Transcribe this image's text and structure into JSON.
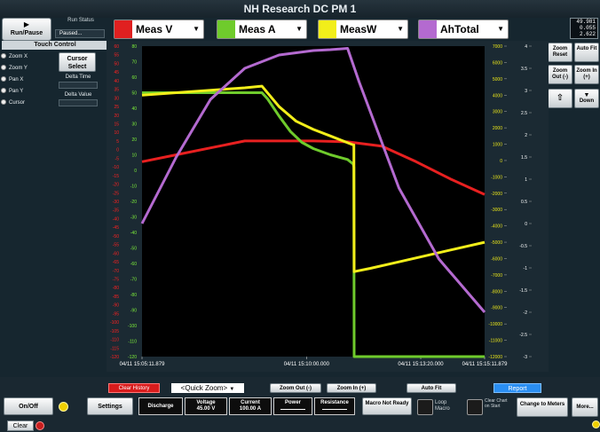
{
  "app": {
    "title": "NH Research DC PM 1"
  },
  "run": {
    "button_label": "Run/Pause",
    "status_label": "Run Status",
    "status_value": "Paused..."
  },
  "touch_control": {
    "header": "Touch Control",
    "options": [
      "Zoom X",
      "Zoom Y",
      "Pan X",
      "Pan Y",
      "Cursor"
    ],
    "cursor_select": "Cursor Select",
    "delta_time_label": "Delta Time",
    "delta_value_label": "Delta Value"
  },
  "channels": [
    {
      "name": "Meas V",
      "color": "#e02020"
    },
    {
      "name": "Meas A",
      "color": "#6fcb2c"
    },
    {
      "name": "MeasW",
      "color": "#f2ee1a"
    },
    {
      "name": "AhTotal",
      "color": "#b46ad0"
    }
  ],
  "readout": [
    "49.981",
    "0.055",
    "2.622"
  ],
  "right_buttons": {
    "zoom_reset": "Zoom Reset",
    "auto_fit": "Auto Fit",
    "zoom_out": "Zoom Out (-)",
    "zoom_in": "Zoom In (+)",
    "up": "Up",
    "down": "Down"
  },
  "chart_data": {
    "type": "line",
    "x_tick_labels": [
      "04/11 15:05:11.879",
      "04/11 15:10:00.000",
      "04/11 15:13:20.000",
      "04/11 15:15:11.879"
    ],
    "x_range_seconds": [
      0,
      600
    ],
    "x_tick_seconds": [
      0,
      288.121,
      488.121,
      600
    ],
    "axes": {
      "volts": {
        "ticks": [
          60,
          55,
          50,
          45,
          40,
          35,
          30,
          25,
          20,
          15,
          10,
          5,
          0,
          -5,
          -10,
          -15,
          -20,
          -25,
          -30,
          -35,
          -40,
          -45,
          -50,
          -55,
          -60,
          -65,
          -70,
          -75,
          -80,
          -85,
          -90,
          -95,
          -100,
          -105,
          -110,
          -115,
          -120
        ],
        "range": [
          -120,
          60
        ],
        "color": "#ff2020"
      },
      "amps": {
        "ticks": [
          80,
          70,
          60,
          50,
          40,
          30,
          20,
          10,
          0,
          -10,
          -20,
          -30,
          -40,
          -50,
          -60,
          -70,
          -80,
          -90,
          -100,
          -110,
          -120
        ],
        "range": [
          -120,
          80
        ],
        "color": "#7ef03a"
      },
      "watts": {
        "ticks": [
          7000,
          6000,
          5000,
          4000,
          3000,
          2000,
          1000,
          0,
          -1000,
          -2000,
          -3000,
          -4000,
          -5000,
          -6000,
          -7000,
          -8000,
          -9000,
          -10000,
          -11000,
          -12000
        ],
        "range": [
          -12000,
          7000
        ],
        "color": "#e8e41a"
      },
      "amp_hours": {
        "ticks": [
          4,
          3.5,
          3,
          2.5,
          2,
          1.5,
          1,
          0.5,
          0,
          -0.5,
          -1,
          -1.5,
          -2,
          -2.5,
          -3
        ],
        "range": [
          -3,
          4
        ],
        "color": "#ffffff"
      }
    },
    "series": [
      {
        "name": "Meas V",
        "axis": "volts",
        "color": "#e82020",
        "x": [
          0,
          60,
          120,
          180,
          240,
          300,
          360,
          420,
          480,
          540,
          600
        ],
        "y": [
          -7,
          -3,
          1,
          5,
          5,
          5,
          4.5,
          2,
          -7,
          -17,
          -26
        ]
      },
      {
        "name": "Meas A",
        "axis": "amps",
        "color": "#6fcb2c",
        "x": [
          0,
          40,
          80,
          120,
          160,
          210,
          220,
          240,
          260,
          280,
          300,
          330,
          360,
          370,
          371,
          371.5,
          380,
          450,
          500,
          550,
          600
        ],
        "y": [
          50,
          50,
          50,
          50,
          50,
          50,
          46,
          35,
          25,
          18,
          14,
          10,
          7,
          4,
          2,
          -120,
          -120,
          -120,
          -120,
          -120,
          -120
        ]
      },
      {
        "name": "MeasW",
        "axis": "watts",
        "color": "#f2ee1a",
        "x": [
          0,
          60,
          120,
          180,
          210,
          240,
          270,
          300,
          330,
          370,
          371,
          371.5,
          400,
          450,
          500,
          550,
          600
        ],
        "y": [
          4000,
          4150,
          4300,
          4450,
          4550,
          3300,
          2400,
          1900,
          1500,
          950,
          950,
          -6800,
          -6600,
          -6200,
          -5800,
          -5400,
          -5000
        ]
      },
      {
        "name": "AhTotal",
        "axis": "amp_hours",
        "color": "#b46ad0",
        "x": [
          0,
          60,
          120,
          180,
          240,
          270,
          300,
          330,
          360,
          380,
          450,
          520,
          600
        ],
        "y": [
          0,
          1.5,
          2.8,
          3.5,
          3.8,
          3.85,
          3.9,
          3.92,
          3.95,
          3.2,
          0.8,
          -0.8,
          -2
        ]
      }
    ],
    "grid": false
  },
  "bottom": {
    "clear_history": "Clear History",
    "quick_zoom": "<Quick Zoom>",
    "zoom_out": "Zoom Out (-)",
    "zoom_in": "Zoom In (+)",
    "auto_fit": "Auto Fit",
    "report": "Report",
    "on_off": "On/Off",
    "settings": "Settings",
    "discharge": "Discharge",
    "voltage": {
      "label": "Voltage",
      "value": "45.00 V"
    },
    "current": {
      "label": "Current",
      "value": "100.00 A"
    },
    "power": {
      "label": "Power",
      "value": ""
    },
    "resistance": {
      "label": "Resistance",
      "value": ""
    },
    "macro": "Macro Not Ready",
    "loop_macro": "Loop Macro",
    "clear_chart": "Clear Chart on Start",
    "change_meters": "Change to Meters",
    "more": "More...",
    "clear": "Clear"
  }
}
